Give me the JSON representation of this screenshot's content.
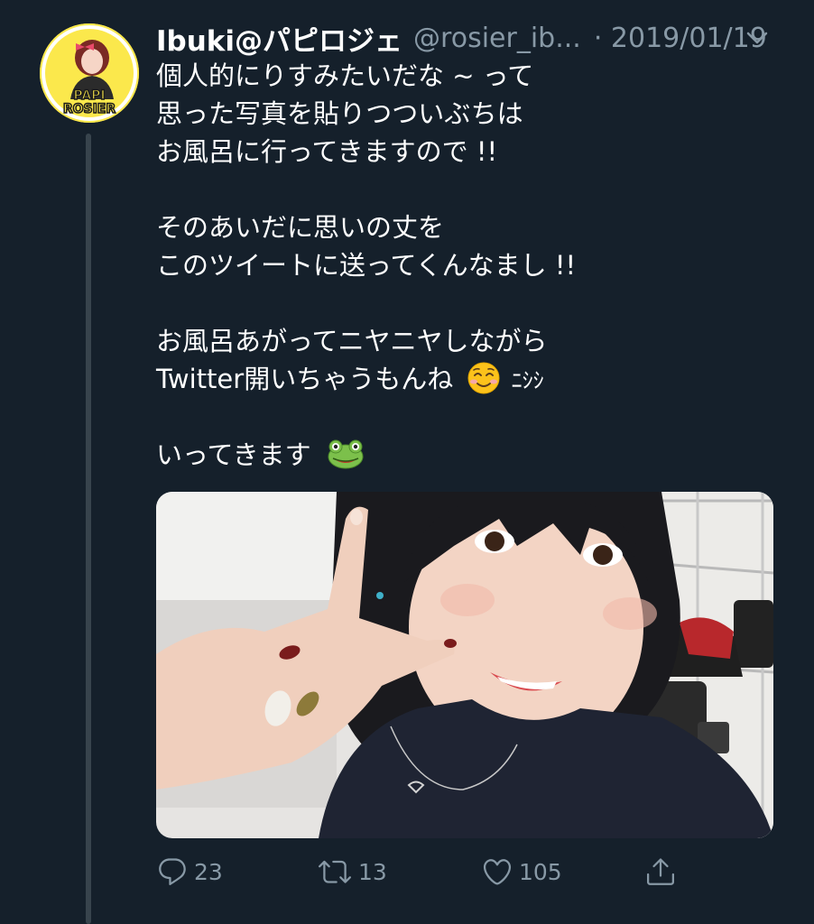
{
  "tweet": {
    "display_name": "Ibuki@パピロジェ",
    "handle": "@rosier_ib...",
    "date": "· 2019/01/19",
    "lines": [
      "個人的にりすみたいだな ~ って",
      "思った写真を貼りつついぶちは",
      "お風呂に行ってきますので !!",
      "",
      "そのあいだに思いの丈を",
      "このツイートに送ってくんなまし !!",
      "",
      "お風呂あがってニヤニヤしながら",
      "Twitter開いちゃうもんね",
      "",
      "いってきます"
    ],
    "line9_suffix": "ﾆｼｼ",
    "avatar_logo_line1": "PAPI",
    "avatar_logo_line2": "ROSIER"
  },
  "actions": {
    "reply_count": "23",
    "retweet_count": "13",
    "like_count": "105"
  },
  "icons": {
    "chevron": "chevron-down-icon",
    "reply": "reply-icon",
    "retweet": "retweet-icon",
    "like": "heart-icon",
    "share": "share-icon"
  },
  "colors": {
    "background": "#15202b",
    "secondary_text": "#8899a6",
    "thread_line": "#38444d"
  }
}
